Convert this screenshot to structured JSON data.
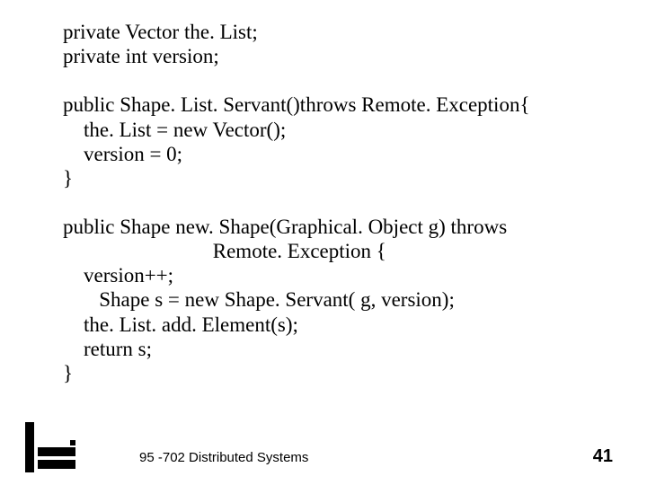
{
  "code": {
    "l1": "private Vector the. List;",
    "l2": "private int version;",
    "l3": "",
    "l4": "public Shape. List. Servant()throws Remote. Exception{",
    "l5": "    the. List = new Vector();",
    "l6": "    version = 0;",
    "l7": "}",
    "l8": "",
    "l9a": "public Shape new. Shape(Graphical. Object g) throws",
    "l9b": "                             Remote. Exception {",
    "l10": "    version++;",
    "l11": "       Shape s = new Shape. Servant( g, version);",
    "l12": "    the. List. add. Element(s);",
    "l13": "    return s;",
    "l14": "}"
  },
  "footer": "95 -702 Distributed Systems",
  "page": "41"
}
